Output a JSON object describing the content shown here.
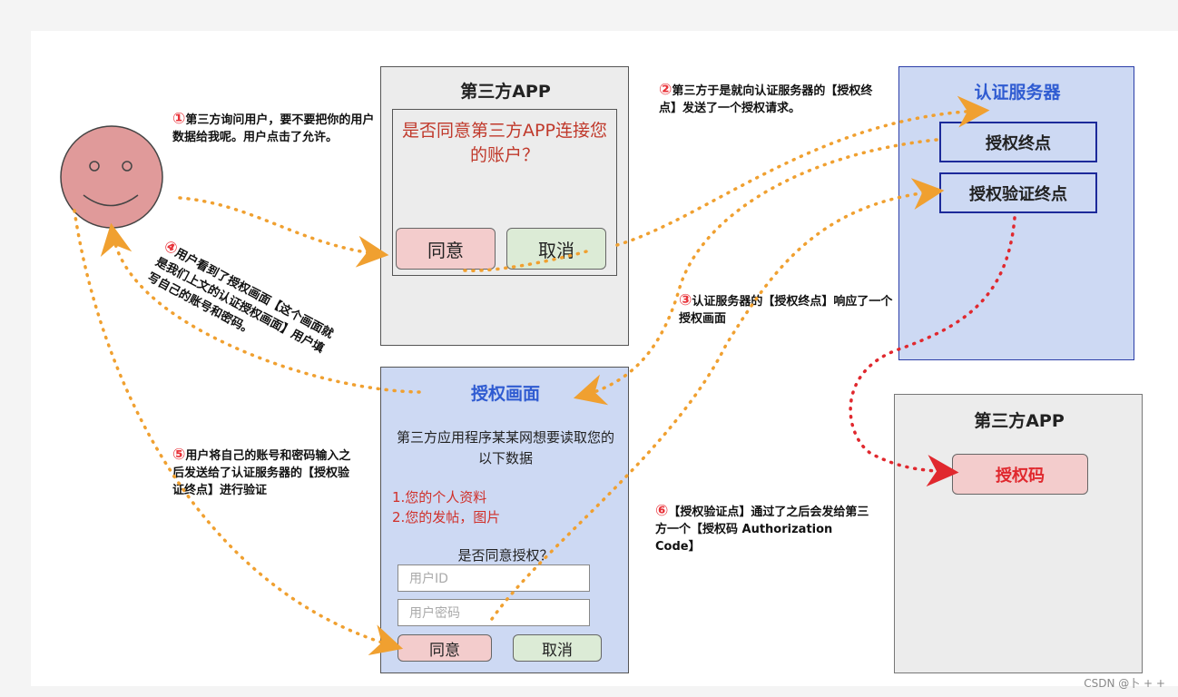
{
  "app_box": {
    "title": "第三方APP",
    "prompt": "是否同意第三方APP连接您的账户？",
    "agree": "同意",
    "cancel": "取消"
  },
  "auth_server": {
    "title": "认证服务器",
    "endpoint_auth": "授权终点",
    "endpoint_verify": "授权验证终点"
  },
  "auth_screen": {
    "title": "授权画面",
    "intro": "第三方应用程序某某网想要读取您的以下数据",
    "item1": "1.您的个人资料",
    "item2": "2.您的发帖，图片",
    "question": "是否同意授权？",
    "user_id_placeholder": "用户ID",
    "password_placeholder": "用户密码",
    "agree": "同意",
    "cancel": "取消"
  },
  "app_box2": {
    "title": "第三方APP",
    "code": "授权码"
  },
  "notes": {
    "n1_num": "①",
    "n1_text": "第三方询问用户，要不要把你的用户数据给我呢。用户点击了允许。",
    "n2_num": "②",
    "n2_text": "第三方于是就向认证服务器的【授权终点】发送了一个授权请求。",
    "n3_num": "③",
    "n3_text": "认证服务器的【授权终点】响应了一个授权画面",
    "n4_num": "④",
    "n4_text": "用户看到了授权画面【这个画面就是我们上文的认证授权画面】用户填写自己的账号和密码。",
    "n5_num": "⑤",
    "n5_text": "用户将自己的账号和密码输入之后发送给了认证服务器的【授权验证终点】进行验证",
    "n6_num": "⑥",
    "n6_text": "【授权验证点】通过了之后会发给第三方一个【授权码 Authorization Code】"
  },
  "watermark": "CSDN @卜 + +",
  "colors": {
    "arrow_orange": "#f0a030",
    "arrow_red": "#e0282e",
    "title_blue": "#2f5bd1",
    "prompt_red": "#c0392b"
  }
}
